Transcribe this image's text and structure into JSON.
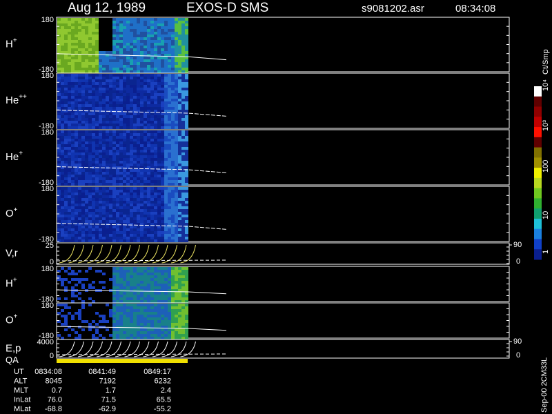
{
  "header": {
    "date": "Aug 12, 1989",
    "instrument": "EXOS-D SMS",
    "file": "s9081202.asr",
    "time": "08:34:08"
  },
  "colorbar": {
    "unit": "Ct/Smp",
    "labels": [
      "1",
      "10",
      "100",
      "10³",
      "10⁴"
    ],
    "colors": [
      "#0a1f8f",
      "#1040c8",
      "#1a80e0",
      "#1ec0d8",
      "#10a070",
      "#30b030",
      "#70c820",
      "#b8d820",
      "#f0f000",
      "#a09000",
      "#807000",
      "#600000",
      "#ff1000",
      "#c00000",
      "#900000",
      "#600000",
      "#ffffff"
    ]
  },
  "footer_tag": "Sep-00 2CM33L",
  "panels": [
    {
      "label": "H",
      "sup": "+",
      "ymax": "180",
      "ymin": "-180",
      "style": "hplus"
    },
    {
      "label": "He",
      "sup": "++",
      "ymax": "180",
      "ymin": "-180",
      "style": "blue"
    },
    {
      "label": "He",
      "sup": "+",
      "ymax": "180",
      "ymin": "-180",
      "style": "blue"
    },
    {
      "label": "O",
      "sup": "+",
      "ymax": "180",
      "ymin": "-180",
      "style": "blue"
    },
    {
      "label": "V,r",
      "sup": "",
      "ymax": "25",
      "ymin": "0",
      "style": "vr",
      "right_top": "90",
      "right_bottom": "0"
    },
    {
      "label": "H",
      "sup": "+",
      "ymax": "180",
      "ymin": "-180",
      "style": "mixed"
    },
    {
      "label": "O",
      "sup": "+",
      "ymax": "180",
      "ymin": "-180",
      "style": "mixed"
    },
    {
      "label": "E,p",
      "sup": "",
      "ymax": "4000",
      "ymin": "0",
      "style": "ep",
      "right_top": "90",
      "right_bottom": "0"
    }
  ],
  "qa_label": "QA",
  "orbit": {
    "rows": [
      {
        "name": "UT",
        "values": [
          "0834:08",
          "0841:49",
          "0849:17"
        ]
      },
      {
        "name": "ALT",
        "values": [
          "8045",
          "7192",
          "6232"
        ]
      },
      {
        "name": "MLT",
        "values": [
          "0.7",
          "1.7",
          "2.4"
        ]
      },
      {
        "name": "InLat",
        "values": [
          "76.0",
          "71.5",
          "65.5"
        ]
      },
      {
        "name": "MLat",
        "values": [
          "-68.8",
          "-62.9",
          "-55.2"
        ]
      }
    ]
  }
}
